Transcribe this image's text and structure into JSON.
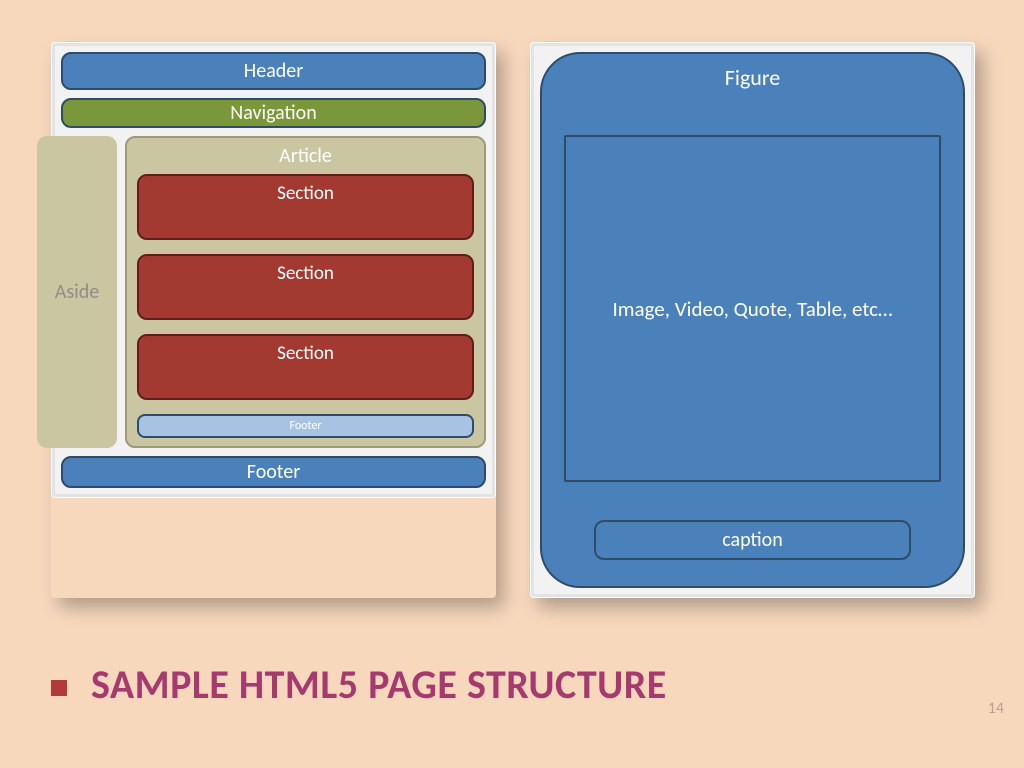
{
  "left": {
    "header": "Header",
    "navigation": "Navigation",
    "aside": "Aside",
    "article": "Article",
    "sections": [
      "Section",
      "Section",
      "Section"
    ],
    "inner_footer": "Footer",
    "footer": "Footer"
  },
  "right": {
    "figure": "Figure",
    "content": "Image, Video, Quote, Table, etc…",
    "caption": "caption"
  },
  "title": "SAMPLE HTML5 PAGE STRUCTURE",
  "page_number": "14"
}
